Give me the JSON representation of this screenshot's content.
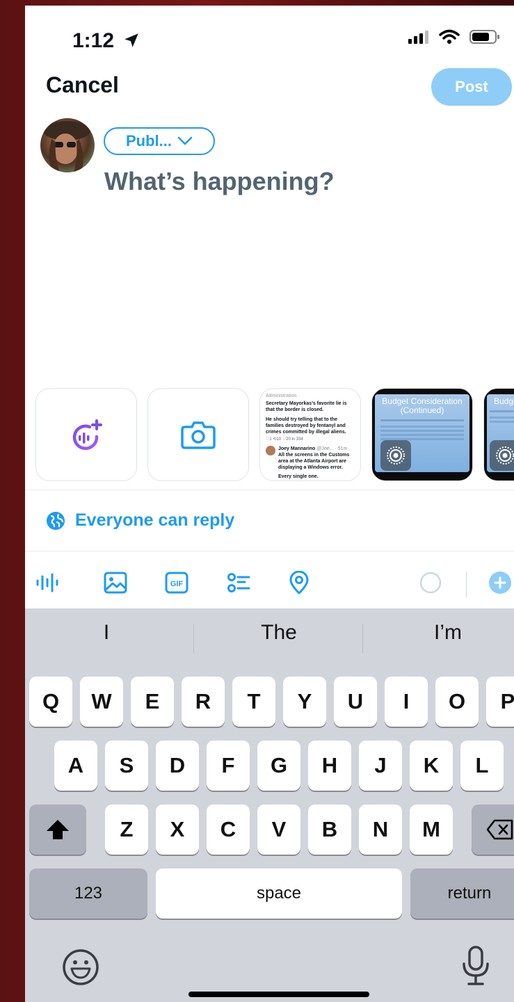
{
  "status_bar": {
    "time": "1:12"
  },
  "header": {
    "cancel_label": "Cancel",
    "post_label": "Post"
  },
  "composer": {
    "audience_label": "Publ...",
    "placeholder": "What’s happening?"
  },
  "media_row": {
    "tweet_thumb": {
      "line0": "Administration",
      "line1": "Secretary Mayorkas’s favorite lie is that the border is closed.",
      "line2": "He should try telling that to the families destroyed by fentanyl and crimes committed by illegal aliens.",
      "stats": "♡1   ⟲10   ♡20   ılı 334",
      "author": "Joey Mannarino",
      "handle": "@Joe... · 51m",
      "line3": "All the screens in the Customs area at the Atlanta Airport are displaying a Windows error.",
      "line4": "Every single one."
    },
    "slide1_title": "Budget Consideration (Continued)",
    "slide2_title": "Budge"
  },
  "reply_setting": {
    "label": "Everyone can reply"
  },
  "toolbar": {
    "icons": [
      "audio-icon",
      "image-icon",
      "gif-icon",
      "poll-icon",
      "location-icon"
    ],
    "gif_label": "GIF"
  },
  "keyboard": {
    "suggestions": [
      "I",
      "The",
      "I’m"
    ],
    "row1": [
      "Q",
      "W",
      "E",
      "R",
      "T",
      "Y",
      "U",
      "I",
      "O",
      "P"
    ],
    "row2": [
      "A",
      "S",
      "D",
      "F",
      "G",
      "H",
      "J",
      "K",
      "L"
    ],
    "row3": [
      "Z",
      "X",
      "C",
      "V",
      "B",
      "N",
      "M"
    ],
    "numbers_label": "123",
    "space_label": "space",
    "return_label": "return"
  },
  "colors": {
    "accent": "#1d9bf0",
    "post_disabled": "#8ecdf8",
    "text": "#0f1419",
    "placeholder": "#536471"
  }
}
